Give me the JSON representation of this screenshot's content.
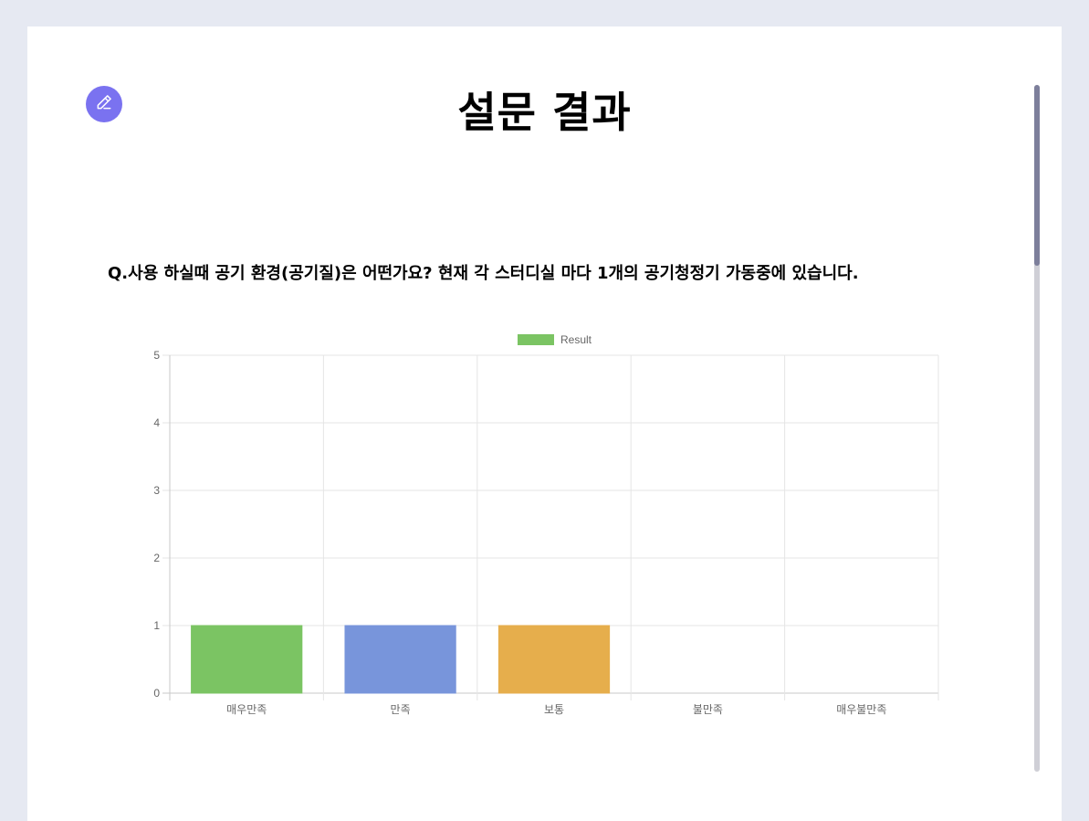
{
  "header": {
    "title": "설문 결과",
    "edit_icon": "pencil-icon"
  },
  "question": {
    "text": "Q.사용 하실때 공기 환경(공기질)은 어떤가요? 현재 각 스터디실 마다 1개의 공기청정기 가동중에 있습니다."
  },
  "chart_data": {
    "type": "bar",
    "categories": [
      "매우만족",
      "만족",
      "보통",
      "불만족",
      "매우불만족"
    ],
    "series": [
      {
        "name": "Result",
        "values": [
          1,
          1,
          1,
          0,
          0
        ],
        "colors": [
          "#7bc463",
          "#7895db",
          "#e6ae4c",
          "#e6e6e6",
          "#e6e6e6"
        ]
      }
    ],
    "legend_color": "#7bc463",
    "title": "",
    "xlabel": "",
    "ylabel": "",
    "ylim": [
      0,
      5
    ],
    "yticks": [
      0,
      1,
      2,
      3,
      4,
      5
    ],
    "grid": true,
    "legend_position": "top-center"
  },
  "colors": {
    "background": "#e6e9f2",
    "card": "#ffffff",
    "accent": "#7a72f0",
    "scroll_thumb": "#7d7f9b"
  }
}
